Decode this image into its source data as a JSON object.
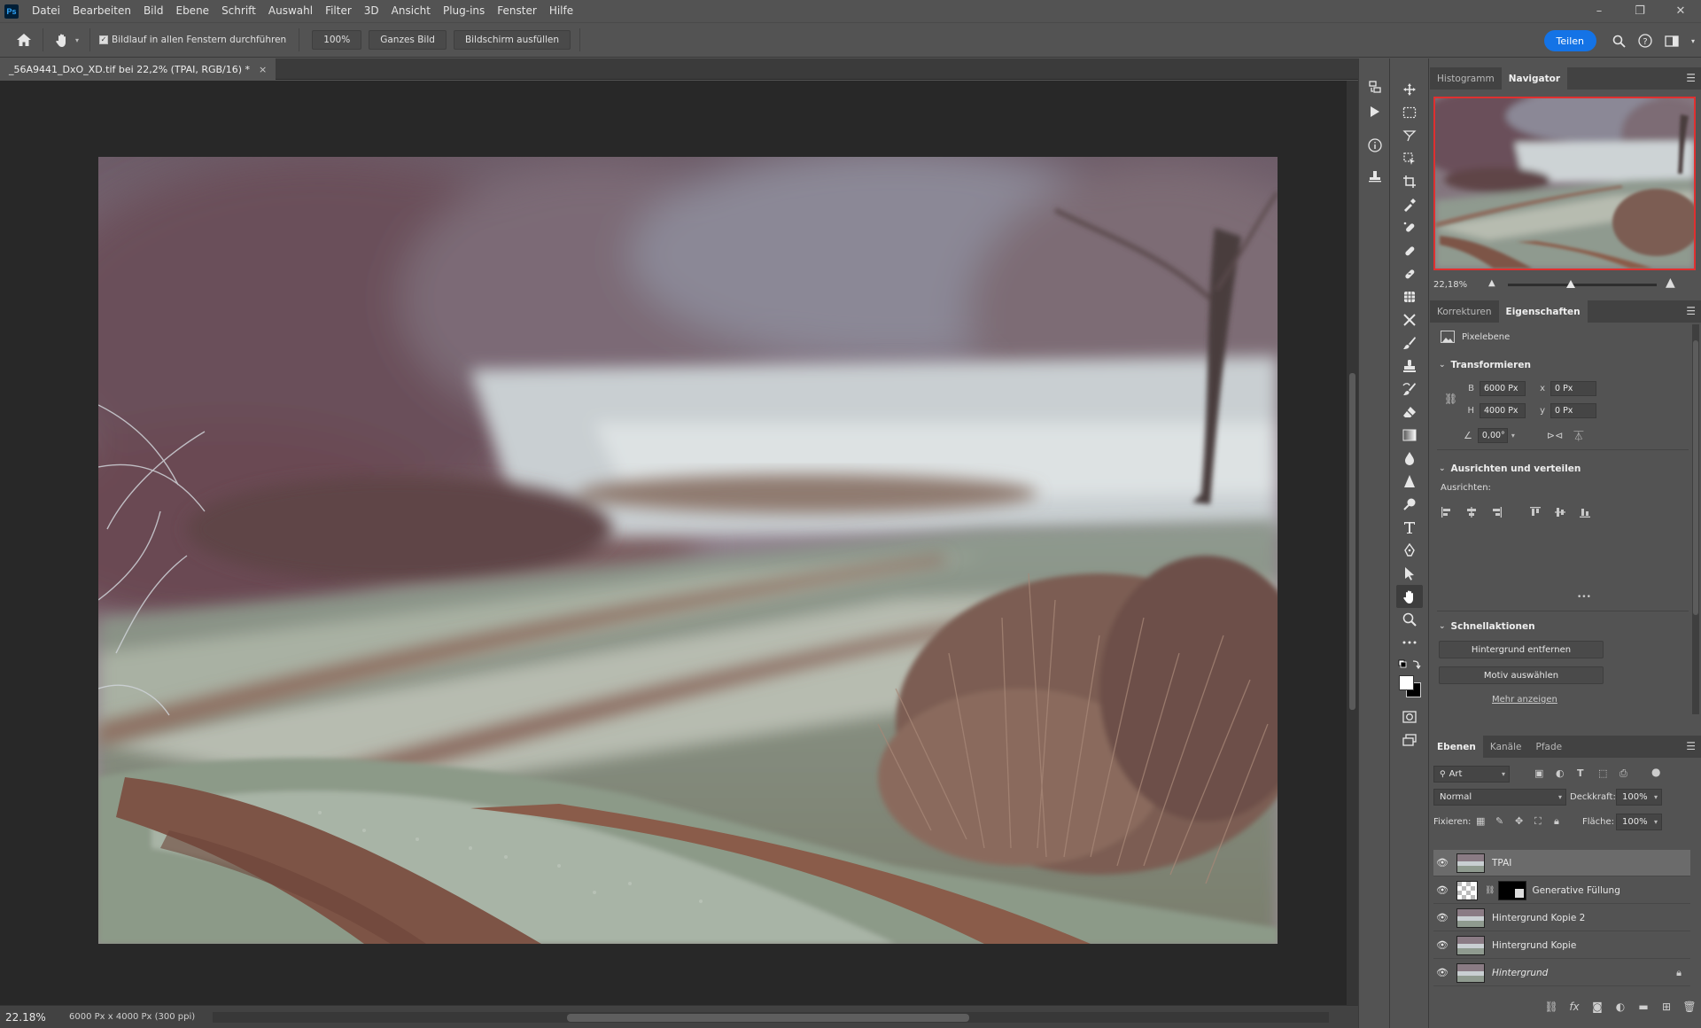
{
  "app": {
    "logo": "Ps"
  },
  "menu": {
    "items": [
      "Datei",
      "Bearbeiten",
      "Bild",
      "Ebene",
      "Schrift",
      "Auswahl",
      "Filter",
      "3D",
      "Ansicht",
      "Plug-ins",
      "Fenster",
      "Hilfe"
    ]
  },
  "window_controls": {
    "minimize": "–",
    "restore": "❐",
    "close": "✕"
  },
  "options": {
    "home_icon": "home-icon",
    "tool_icon": "hand-icon",
    "scroll_all_label": "Bildlauf in allen Fenstern durchführen",
    "scroll_all_checked": true,
    "zoom_100_label": "100%",
    "fit_screen_label": "Ganzes Bild",
    "fill_screen_label": "Bildschirm ausfüllen",
    "share_label": "Teilen"
  },
  "document": {
    "tab_title": "_56A9441_DxO_XD.tif bei 22,2% (TPAI, RGB/16) *",
    "close_glyph": "×"
  },
  "status": {
    "zoom": "22.18%",
    "info": "6000 Px x 4000 Px (300 ppi)"
  },
  "navigator": {
    "tabs": [
      "Histogramm",
      "Navigator"
    ],
    "active_tab": "Navigator",
    "zoom": "22,18%",
    "zoom_fraction": 0.42
  },
  "properties": {
    "tabs": [
      "Korrekturen",
      "Eigenschaften"
    ],
    "active_tab": "Eigenschaften",
    "layer_type": "Pixelebene",
    "transform_header": "Transformieren",
    "b_label": "B",
    "b_value": "6000 Px",
    "h_label": "H",
    "h_value": "4000 Px",
    "x_label": "x",
    "x_value": "0 Px",
    "y_label": "y",
    "y_value": "0 Px",
    "angle_value": "0,00°",
    "align_header": "Ausrichten und verteilen",
    "align_label": "Ausrichten:",
    "more_glyph": "•••",
    "quick_header": "Schnellaktionen",
    "remove_bg_label": "Hintergrund entfernen",
    "select_subject_label": "Motiv auswählen",
    "show_more_label": "Mehr anzeigen"
  },
  "layers": {
    "tabs": [
      "Ebenen",
      "Kanäle",
      "Pfade"
    ],
    "active_tab": "Ebenen",
    "filter_label": "Art",
    "blend_mode": "Normal",
    "opacity_label": "Deckkraft:",
    "opacity_value": "100%",
    "lock_label": "Fixieren:",
    "fill_label": "Fläche:",
    "fill_value": "100%",
    "items": [
      {
        "name": "TPAI",
        "selected": true,
        "kind": "photo"
      },
      {
        "name": "Generative Füllung",
        "selected": false,
        "kind": "generative"
      },
      {
        "name": "Hintergrund Kopie 2",
        "selected": false,
        "kind": "photo"
      },
      {
        "name": "Hintergrund Kopie",
        "selected": false,
        "kind": "photo"
      },
      {
        "name": "Hintergrund",
        "selected": false,
        "kind": "photo",
        "locked": true,
        "italic": true
      }
    ]
  },
  "colors": {
    "accent": "#1473e6",
    "navigator_frame": "#e03030",
    "foreground_swatch": "#ffffff",
    "background_swatch": "#000000"
  }
}
